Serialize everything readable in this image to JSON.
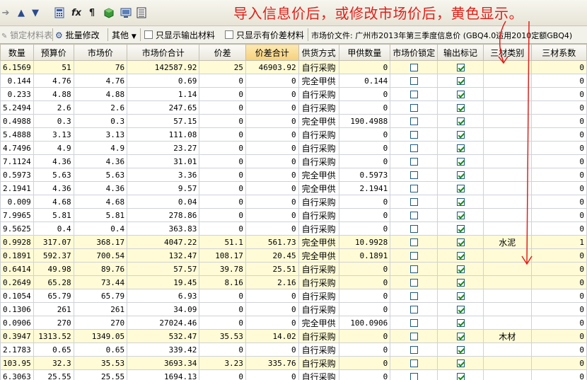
{
  "annotation": "导入信息价后，或修改市场价后，黄色显示。",
  "toolbar": {
    "icons": [
      "arrow-right-icon",
      "move-up-icon",
      "move-down-icon",
      "calculator-icon",
      "formula-icon",
      "paragraph-icon",
      "cube-icon",
      "monitor-icon",
      "list-icon"
    ],
    "lock_materials_label": "锁定材料表",
    "batch_edit_label": "批量修改",
    "other_label": "其他",
    "show_output_only_label": "只显示输出材料",
    "show_diff_only_label": "只显示有价差材料",
    "price_file_label": "市场价文件: 广州市2013年第三季度信息价 (GBQ4.0适用2010定额GBQ4)"
  },
  "colors": {
    "annotation": "#e0201a",
    "highlight_row": "#fefbd6",
    "header_highlight": "#f6d07a"
  },
  "columns": [
    "数量",
    "预算价",
    "市场价",
    "市场价合计",
    "价差",
    "价差合计",
    "供货方式",
    "甲供数量",
    "市场价锁定",
    "输出标记",
    "三材类别",
    "三材系数"
  ],
  "rows": [
    {
      "q": "6.1569",
      "budget": "51",
      "market": "76",
      "total": "142587.92",
      "diff": "25",
      "diff_total": "46903.92",
      "supply": "自行采购",
      "jia": "0",
      "lock": false,
      "out": true,
      "cat": "",
      "coef": "0",
      "hl": true
    },
    {
      "q": "0.144",
      "budget": "4.76",
      "market": "4.76",
      "total": "0.69",
      "diff": "0",
      "diff_total": "0",
      "supply": "完全甲供",
      "jia": "0.144",
      "lock": false,
      "out": true,
      "cat": "",
      "coef": "0",
      "hl": false
    },
    {
      "q": "0.233",
      "budget": "4.88",
      "market": "4.88",
      "total": "1.14",
      "diff": "0",
      "diff_total": "0",
      "supply": "自行采购",
      "jia": "0",
      "lock": false,
      "out": true,
      "cat": "",
      "coef": "0",
      "hl": false
    },
    {
      "q": "5.2494",
      "budget": "2.6",
      "market": "2.6",
      "total": "247.65",
      "diff": "0",
      "diff_total": "0",
      "supply": "自行采购",
      "jia": "0",
      "lock": false,
      "out": true,
      "cat": "",
      "coef": "0",
      "hl": false
    },
    {
      "q": "0.4988",
      "budget": "0.3",
      "market": "0.3",
      "total": "57.15",
      "diff": "0",
      "diff_total": "0",
      "supply": "完全甲供",
      "jia": "190.4988",
      "lock": false,
      "out": true,
      "cat": "",
      "coef": "0",
      "hl": false
    },
    {
      "q": "5.4888",
      "budget": "3.13",
      "market": "3.13",
      "total": "111.08",
      "diff": "0",
      "diff_total": "0",
      "supply": "自行采购",
      "jia": "0",
      "lock": false,
      "out": true,
      "cat": "",
      "coef": "0",
      "hl": false
    },
    {
      "q": "4.7496",
      "budget": "4.9",
      "market": "4.9",
      "total": "23.27",
      "diff": "0",
      "diff_total": "0",
      "supply": "自行采购",
      "jia": "0",
      "lock": false,
      "out": true,
      "cat": "",
      "coef": "0",
      "hl": false
    },
    {
      "q": "7.1124",
      "budget": "4.36",
      "market": "4.36",
      "total": "31.01",
      "diff": "0",
      "diff_total": "0",
      "supply": "自行采购",
      "jia": "0",
      "lock": false,
      "out": true,
      "cat": "",
      "coef": "0",
      "hl": false
    },
    {
      "q": "0.5973",
      "budget": "5.63",
      "market": "5.63",
      "total": "3.36",
      "diff": "0",
      "diff_total": "0",
      "supply": "完全甲供",
      "jia": "0.5973",
      "lock": false,
      "out": true,
      "cat": "",
      "coef": "0",
      "hl": false
    },
    {
      "q": "2.1941",
      "budget": "4.36",
      "market": "4.36",
      "total": "9.57",
      "diff": "0",
      "diff_total": "0",
      "supply": "完全甲供",
      "jia": "2.1941",
      "lock": false,
      "out": true,
      "cat": "",
      "coef": "0",
      "hl": false
    },
    {
      "q": "0.009",
      "budget": "4.68",
      "market": "4.68",
      "total": "0.04",
      "diff": "0",
      "diff_total": "0",
      "supply": "自行采购",
      "jia": "0",
      "lock": false,
      "out": true,
      "cat": "",
      "coef": "0",
      "hl": false
    },
    {
      "q": "7.9965",
      "budget": "5.81",
      "market": "5.81",
      "total": "278.86",
      "diff": "0",
      "diff_total": "0",
      "supply": "自行采购",
      "jia": "0",
      "lock": false,
      "out": true,
      "cat": "",
      "coef": "0",
      "hl": false
    },
    {
      "q": "9.5625",
      "budget": "0.4",
      "market": "0.4",
      "total": "363.83",
      "diff": "0",
      "diff_total": "0",
      "supply": "自行采购",
      "jia": "0",
      "lock": false,
      "out": true,
      "cat": "",
      "coef": "0",
      "hl": false
    },
    {
      "q": "0.9928",
      "budget": "317.07",
      "market": "368.17",
      "total": "4047.22",
      "diff": "51.1",
      "diff_total": "561.73",
      "supply": "完全甲供",
      "jia": "10.9928",
      "lock": false,
      "out": true,
      "cat": "水泥",
      "coef": "1",
      "hl": true
    },
    {
      "q": "0.1891",
      "budget": "592.37",
      "market": "700.54",
      "total": "132.47",
      "diff": "108.17",
      "diff_total": "20.45",
      "supply": "完全甲供",
      "jia": "0.1891",
      "lock": false,
      "out": true,
      "cat": "",
      "coef": "0",
      "hl": true
    },
    {
      "q": "0.6414",
      "budget": "49.98",
      "market": "89.76",
      "total": "57.57",
      "diff": "39.78",
      "diff_total": "25.51",
      "supply": "自行采购",
      "jia": "0",
      "lock": false,
      "out": true,
      "cat": "",
      "coef": "0",
      "hl": true
    },
    {
      "q": "0.2649",
      "budget": "65.28",
      "market": "73.44",
      "total": "19.45",
      "diff": "8.16",
      "diff_total": "2.16",
      "supply": "自行采购",
      "jia": "0",
      "lock": false,
      "out": true,
      "cat": "",
      "coef": "0",
      "hl": true
    },
    {
      "q": "0.1054",
      "budget": "65.79",
      "market": "65.79",
      "total": "6.93",
      "diff": "0",
      "diff_total": "0",
      "supply": "自行采购",
      "jia": "0",
      "lock": false,
      "out": true,
      "cat": "",
      "coef": "0",
      "hl": false
    },
    {
      "q": "0.1306",
      "budget": "261",
      "market": "261",
      "total": "34.09",
      "diff": "0",
      "diff_total": "0",
      "supply": "自行采购",
      "jia": "0",
      "lock": false,
      "out": true,
      "cat": "",
      "coef": "0",
      "hl": false
    },
    {
      "q": "0.0906",
      "budget": "270",
      "market": "270",
      "total": "27024.46",
      "diff": "0",
      "diff_total": "0",
      "supply": "完全甲供",
      "jia": "100.0906",
      "lock": false,
      "out": true,
      "cat": "",
      "coef": "0",
      "hl": false
    },
    {
      "q": "0.3947",
      "budget": "1313.52",
      "market": "1349.05",
      "total": "532.47",
      "diff": "35.53",
      "diff_total": "14.02",
      "supply": "自行采购",
      "jia": "0",
      "lock": false,
      "out": true,
      "cat": "木材",
      "coef": "0",
      "hl": true
    },
    {
      "q": "2.1783",
      "budget": "0.65",
      "market": "0.65",
      "total": "339.42",
      "diff": "0",
      "diff_total": "0",
      "supply": "自行采购",
      "jia": "0",
      "lock": false,
      "out": true,
      "cat": "",
      "coef": "0",
      "hl": false
    },
    {
      "q": "103.95",
      "budget": "32.3",
      "market": "35.53",
      "total": "3693.34",
      "diff": "3.23",
      "diff_total": "335.76",
      "supply": "自行采购",
      "jia": "0",
      "lock": false,
      "out": true,
      "cat": "",
      "coef": "0",
      "hl": true
    },
    {
      "q": "6.3063",
      "budget": "25.55",
      "market": "25.55",
      "total": "1694.13",
      "diff": "0",
      "diff_total": "0",
      "supply": "自行采购",
      "jia": "0",
      "lock": false,
      "out": true,
      "cat": "",
      "coef": "0",
      "hl": false
    }
  ]
}
